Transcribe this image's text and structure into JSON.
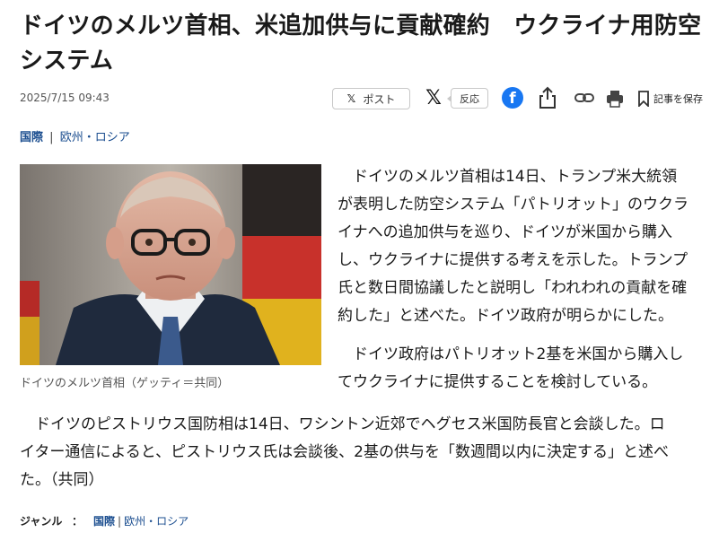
{
  "article": {
    "title_line1": "ドイツのメルツ首相、米追加供与に貢献確約　ウクライナ用防空",
    "title_line2": "システム",
    "date": "2025/7/15 09:43"
  },
  "toolbar": {
    "post_label": "ポスト",
    "post_x": "𝕏",
    "x_logo": "𝕏",
    "reaction_label": "反応",
    "facebook_glyph": "f",
    "save_label": "記事を保存",
    "icons": [
      "x-icon",
      "facebook-icon",
      "share-icon",
      "link-icon",
      "print-icon",
      "bookmark-icon"
    ]
  },
  "categories": {
    "primary": "国際",
    "separator": "|",
    "secondary": "欧州・ロシア"
  },
  "photo": {
    "caption": "ドイツのメルツ首相（ゲッティ＝共同）"
  },
  "body": {
    "p1": [
      "　ドイツのメルツ首相は14日、トランプ米大統領",
      "が表明した防空システム「パトリオット」のウクラ",
      "イナへの追加供与を巡り、ドイツが米国から購入",
      "し、ウクライナに提供する考えを示した。トランプ",
      "氏と数日間協議したと説明し「われわれの貢献を確",
      "約した」と述べた。ドイツ政府が明らかにした。"
    ],
    "p2": [
      "　ドイツ政府はパトリオット2基を米国から購入し",
      "てウクライナに提供することを検討している。"
    ],
    "p3": [
      "　ドイツのピストリウス国防相は14日、ワシントン近郊でヘグセス米国防長官と会談した。ロ",
      "イター通信によると、ピストリウス氏は会談後、2基の供与を「数週間以内に決定する」と述べ",
      "た。（共同）"
    ]
  },
  "genre": {
    "label": "ジャンル",
    "colon": "：",
    "primary": "国際",
    "separator": "|",
    "secondary": "欧州・ロシア"
  },
  "colors": {
    "link": "#1a4d8f",
    "facebook": "#1877f2"
  }
}
